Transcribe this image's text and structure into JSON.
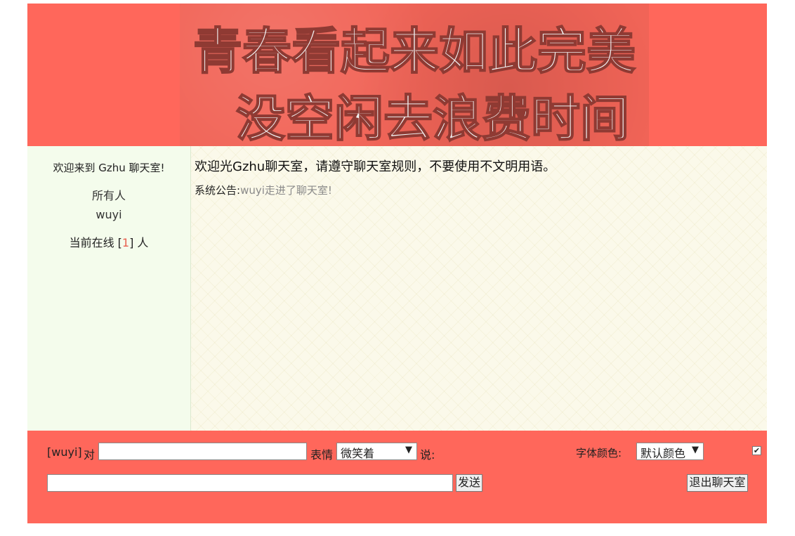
{
  "header": {
    "banner_line1": "青春看起来如此完美",
    "banner_line2": "没空闲去浪费时间"
  },
  "sidebar": {
    "welcome": "欢迎来到 Gzhu 聊天室!",
    "users": [
      "所有人",
      "wuyi"
    ],
    "online_prefix": "当前在线 [",
    "online_count": "1",
    "online_suffix": "] 人"
  },
  "chat": {
    "title": "欢迎光Gzhu聊天室，请遵守聊天室规则，不要使用不文明用语。",
    "announce_label": "系统公告:",
    "announce_message": "wuyi走进了聊天室!"
  },
  "composer": {
    "from_user": "[wuyi]",
    "to_label": "对",
    "target_value": "",
    "emotion_label": "表情",
    "emotion_selected": "微笑着",
    "say_label": "说:",
    "font_color_label": "字体颜色:",
    "font_color_selected": "默认颜色",
    "message_value": "",
    "send_label": "发送",
    "exit_label": "退出聊天室",
    "checkbox_checked": true
  },
  "colors": {
    "brand_red": "#ff675b",
    "sidebar_bg": "#f4fcec",
    "online_count": "#e8604f"
  }
}
